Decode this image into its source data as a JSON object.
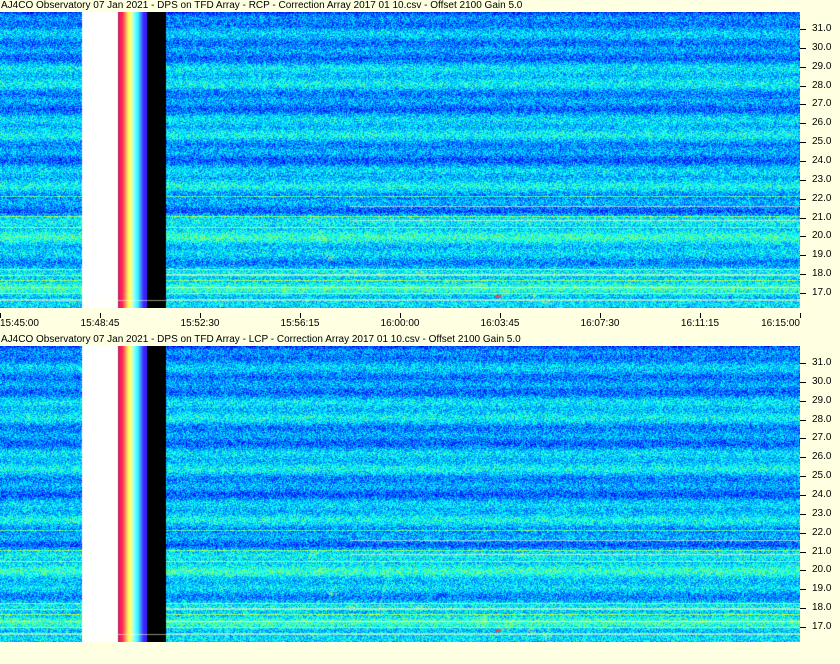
{
  "panels": [
    {
      "id": "rcp",
      "title": "AJ4CO Observatory 07 Jan 2021  -  DPS on TFD Array  -  RCP  -  Correction Array 2017 01 10.csv  -  Offset 2100  Gain 5.0",
      "polarization": "RCP",
      "show_time_axis": true
    },
    {
      "id": "lcp",
      "title": "AJ4CO Observatory 07 Jan 2021  -  DPS on TFD Array  -  LCP  -  Correction Array 2017 01 10.csv  -  Offset 2100  Gain 5.0",
      "polarization": "LCP",
      "show_time_axis": false
    }
  ],
  "freq_axis": {
    "unit": "MHz",
    "min": 16.2,
    "max": 31.9,
    "ticks": [
      "31.0",
      "30.0",
      "29.0",
      "28.0",
      "27.0",
      "26.0",
      "25.0",
      "24.0",
      "23.0",
      "22.0",
      "21.0",
      "20.0",
      "19.0",
      "18.0",
      "17.0"
    ]
  },
  "time_axis": {
    "ticks": [
      "15:45:00",
      "15:48:45",
      "15:52:30",
      "15:56:15",
      "16:00:00",
      "16:03:45",
      "16:07:30",
      "16:11:15",
      "16:15:00"
    ]
  },
  "colors": {
    "background": "#ffffe1",
    "spectrogram_base": "#1e4fd8",
    "noise_band": "#000000",
    "saturated": "#ffffff"
  },
  "features": {
    "calibration_block": "white/rainbow/black calibration band",
    "burst_track": "diagonal drifting emission"
  }
}
